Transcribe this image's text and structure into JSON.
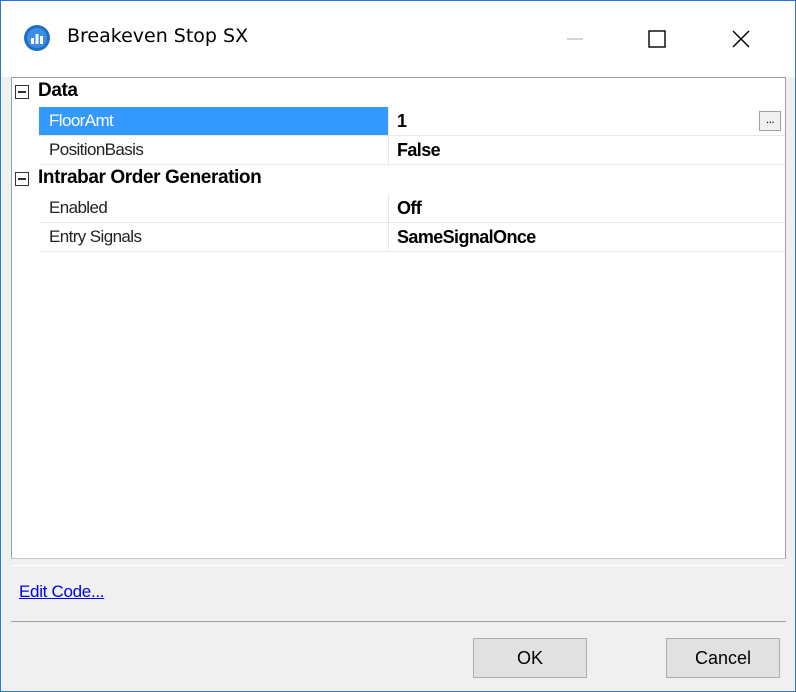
{
  "window": {
    "title": "Breakeven Stop SX",
    "accent": "#2b79d6"
  },
  "grid": {
    "categories": [
      {
        "label": "Data",
        "properties": [
          {
            "name": "FloorAmt",
            "value": "1",
            "selected": true,
            "has_ellipsis": true,
            "ellipsis": "..."
          },
          {
            "name": "PositionBasis",
            "value": "False"
          }
        ]
      },
      {
        "label": "Intrabar Order Generation",
        "properties": [
          {
            "name": "Enabled",
            "value": "Off"
          },
          {
            "name": "Entry Signals",
            "value": "SameSignalOnce"
          }
        ]
      }
    ],
    "selection_color": "#3399ff"
  },
  "footer": {
    "edit_code_link": "Edit Code...",
    "ok_label": "OK",
    "cancel_label": "Cancel"
  }
}
